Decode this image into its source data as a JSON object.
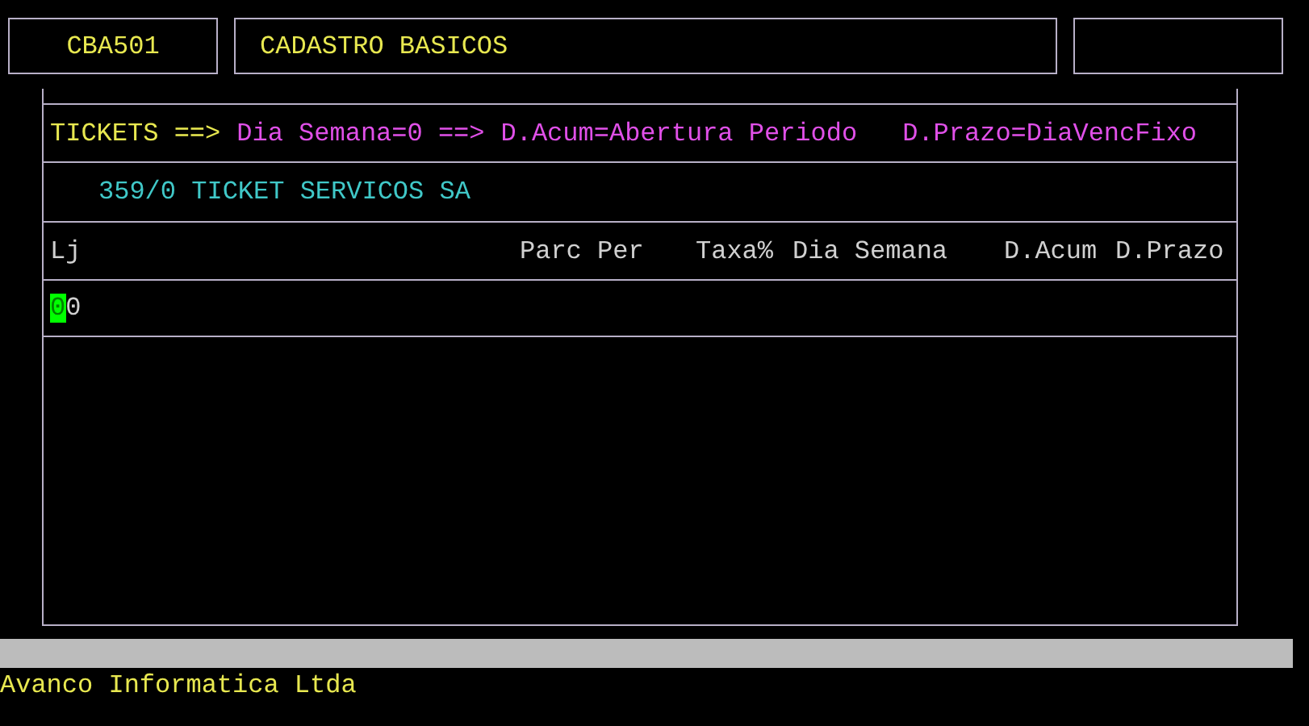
{
  "header": {
    "program_code": "CBA501",
    "title": "CADASTRO BASICOS"
  },
  "info_line": [
    {
      "text": "TICKETS ==>",
      "kind": "label"
    },
    {
      "text": "Dia Semana=0 ==>",
      "kind": "value"
    },
    {
      "text": "D.Acum=Abertura Periodo",
      "kind": "value"
    },
    {
      "text": "D.Prazo=DiaVencFixo",
      "kind": "value"
    }
  ],
  "company": "359/0 TICKET SERVICOS SA",
  "table": {
    "columns": [
      "Lj",
      "Parc Per",
      "Taxa%",
      "Dia Semana",
      "D.Acum",
      "D.Prazo"
    ],
    "rows": [
      {
        "value": "00",
        "cursor": true
      }
    ]
  },
  "footer": "Avanco Informatica Ltda"
}
